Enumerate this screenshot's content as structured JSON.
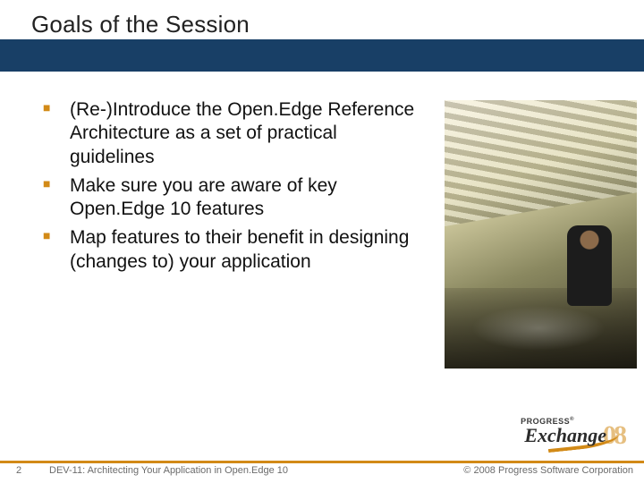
{
  "title": "Goals of the Session",
  "bullets": [
    "(Re-)Introduce the Open.Edge Reference Architecture as a set of practical guidelines",
    "Make sure you are aware of key Open.Edge 10 features",
    "Map features to their benefit in designing (changes to) your application"
  ],
  "footer": {
    "page": "2",
    "title": "DEV-11: Architecting Your Application in Open.Edge 10",
    "copyright": "© 2008 Progress Software Corporation"
  },
  "logo": {
    "progress": "PROGRESS",
    "exchange": "Exchange",
    "year": "08"
  }
}
